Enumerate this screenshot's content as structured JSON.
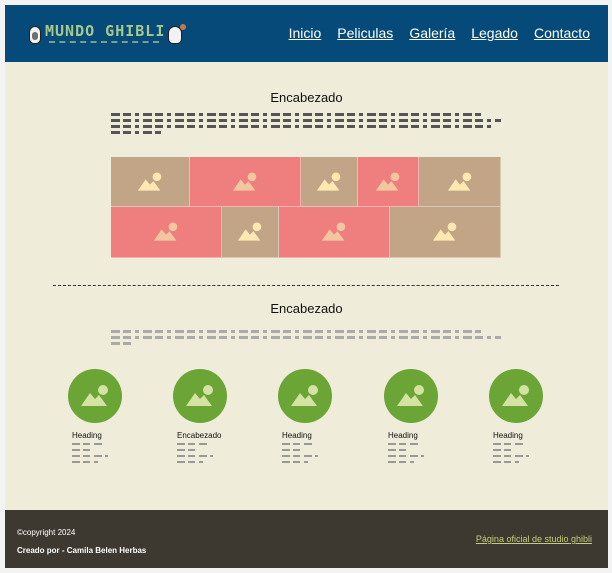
{
  "header": {
    "logo_text": "MUNDO GHIBLI",
    "nav": [
      "Inicio",
      "Peliculas",
      "Galería",
      "Legado",
      "Contacto"
    ],
    "bg_color": "#054a78"
  },
  "section1": {
    "title": "Encabezado"
  },
  "gallery": {
    "colors": {
      "tan": "#c2a487",
      "pink": "#ef7f7e"
    },
    "tiles": [
      {
        "row": 0,
        "tone": "tan"
      },
      {
        "row": 0,
        "tone": "pink"
      },
      {
        "row": 0,
        "tone": "tan"
      },
      {
        "row": 0,
        "tone": "pink"
      },
      {
        "row": 0,
        "tone": "tan"
      },
      {
        "row": 1,
        "tone": "pink"
      },
      {
        "row": 1,
        "tone": "tan"
      },
      {
        "row": 1,
        "tone": "pink"
      },
      {
        "row": 1,
        "tone": "tan"
      }
    ],
    "icon": "image-placeholder-icon"
  },
  "section2": {
    "title": "Encabezado"
  },
  "cards": [
    {
      "caption": "Heading"
    },
    {
      "caption": "Encabezado"
    },
    {
      "caption": "Heading"
    },
    {
      "caption": "Heading"
    },
    {
      "caption": "Heading"
    }
  ],
  "footer": {
    "copyright": "©copyright 2024",
    "credits": "Creado por - Camila Belen Herbas",
    "link": "Página oficial de studio ghibli",
    "bg_color": "#3d3930"
  }
}
